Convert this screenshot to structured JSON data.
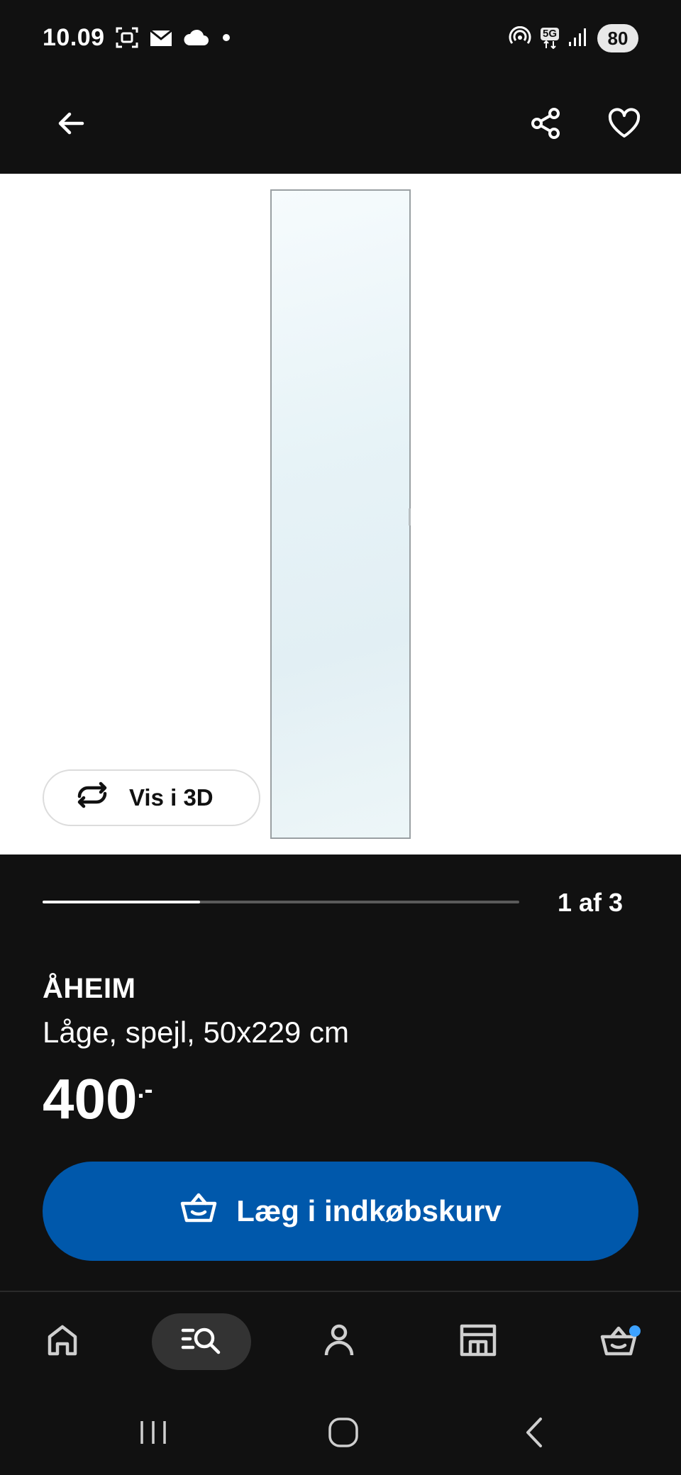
{
  "status_bar": {
    "time": "10.09",
    "net_label": "5G",
    "battery": "80",
    "left_icons": [
      "screenshot-icon",
      "gmail-icon",
      "cloud-icon",
      "dot-icon"
    ],
    "right_icons": [
      "hotspot-icon",
      "5g-icon",
      "signal-icon",
      "battery-icon"
    ]
  },
  "top_nav": {
    "back_icon": "arrow-left-icon",
    "share_icon": "share-icon",
    "favorite_icon": "heart-icon"
  },
  "gallery": {
    "view_3d_label": "Vis i 3D",
    "current_index": 1,
    "total": 3,
    "pager_text": "1 af 3",
    "progress_fraction": 0.33
  },
  "product": {
    "name": "ÅHEIM",
    "description": "Låge, spejl, 50x229 cm",
    "price": "400",
    "price_suffix": ".-"
  },
  "cart_button": {
    "label": "Læg i indkøbskurv"
  },
  "tabbar": {
    "items": [
      {
        "icon": "home-icon",
        "active": false
      },
      {
        "icon": "search-icon",
        "active": true
      },
      {
        "icon": "profile-icon",
        "active": false
      },
      {
        "icon": "store-icon",
        "active": false
      },
      {
        "icon": "cart-icon",
        "active": false,
        "badge_color": "#3da2ff"
      }
    ]
  },
  "system_nav": [
    "recents-icon",
    "home-circle-icon",
    "back-chevron-icon"
  ],
  "colors": {
    "background": "#111111",
    "accent": "#0058ab",
    "badge": "#3da2ff"
  }
}
